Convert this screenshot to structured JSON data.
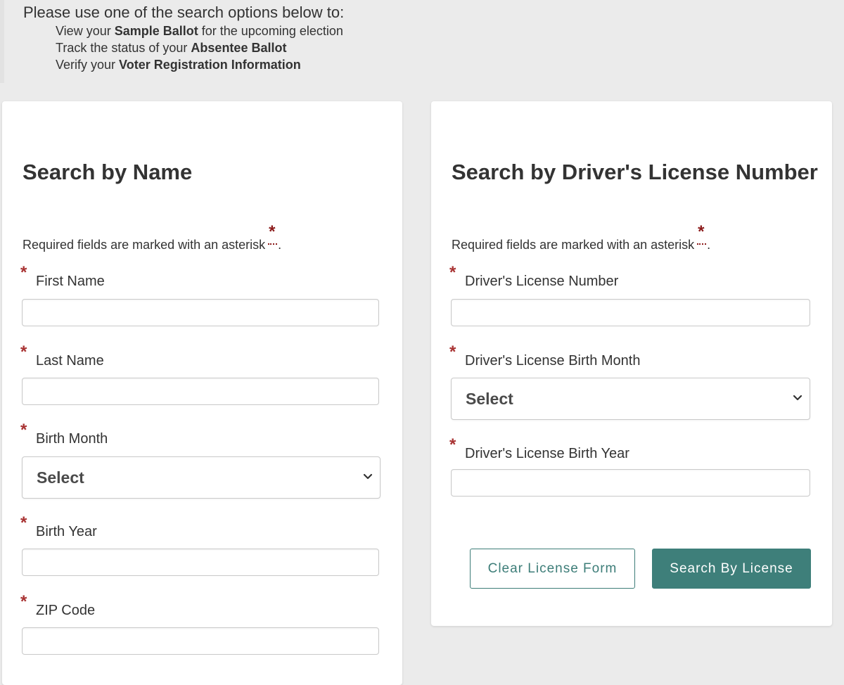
{
  "intro": {
    "heading": "Please use one of the search options below to:",
    "items": [
      {
        "prefix": "View your ",
        "bold": "Sample Ballot",
        "suffix": " for the upcoming election"
      },
      {
        "prefix": "Track the status of your ",
        "bold": "Absentee Ballot",
        "suffix": ""
      },
      {
        "prefix": "Verify your ",
        "bold": "Voter Registration Information",
        "suffix": ""
      }
    ]
  },
  "name_form": {
    "title": "Search by Name",
    "required_note": "Required fields are marked with an asterisk",
    "required_note_end": ".",
    "required_marker": "*",
    "fields": {
      "first_name": {
        "label": "First Name",
        "value": ""
      },
      "last_name": {
        "label": "Last Name",
        "value": ""
      },
      "birth_month": {
        "label": "Birth Month",
        "selected": "Select"
      },
      "birth_year": {
        "label": "Birth Year",
        "value": ""
      },
      "zip_code": {
        "label": "ZIP Code",
        "value": ""
      }
    }
  },
  "license_form": {
    "title": "Search by Driver's License Number",
    "required_note": "Required fields are marked with an asterisk",
    "required_note_end": ".",
    "required_marker": "*",
    "fields": {
      "license_number": {
        "label": "Driver's License Number",
        "value": ""
      },
      "birth_month": {
        "label": "Driver's License Birth Month",
        "selected": "Select"
      },
      "birth_year": {
        "label": "Driver's License Birth Year",
        "value": ""
      }
    },
    "buttons": {
      "clear": "Clear License Form",
      "search": "Search By License"
    }
  },
  "colors": {
    "accent": "#3e7f7a",
    "required": "#a83232",
    "background": "#ebebeb"
  },
  "icons": {
    "select_chevron": "chevron-down-icon"
  }
}
